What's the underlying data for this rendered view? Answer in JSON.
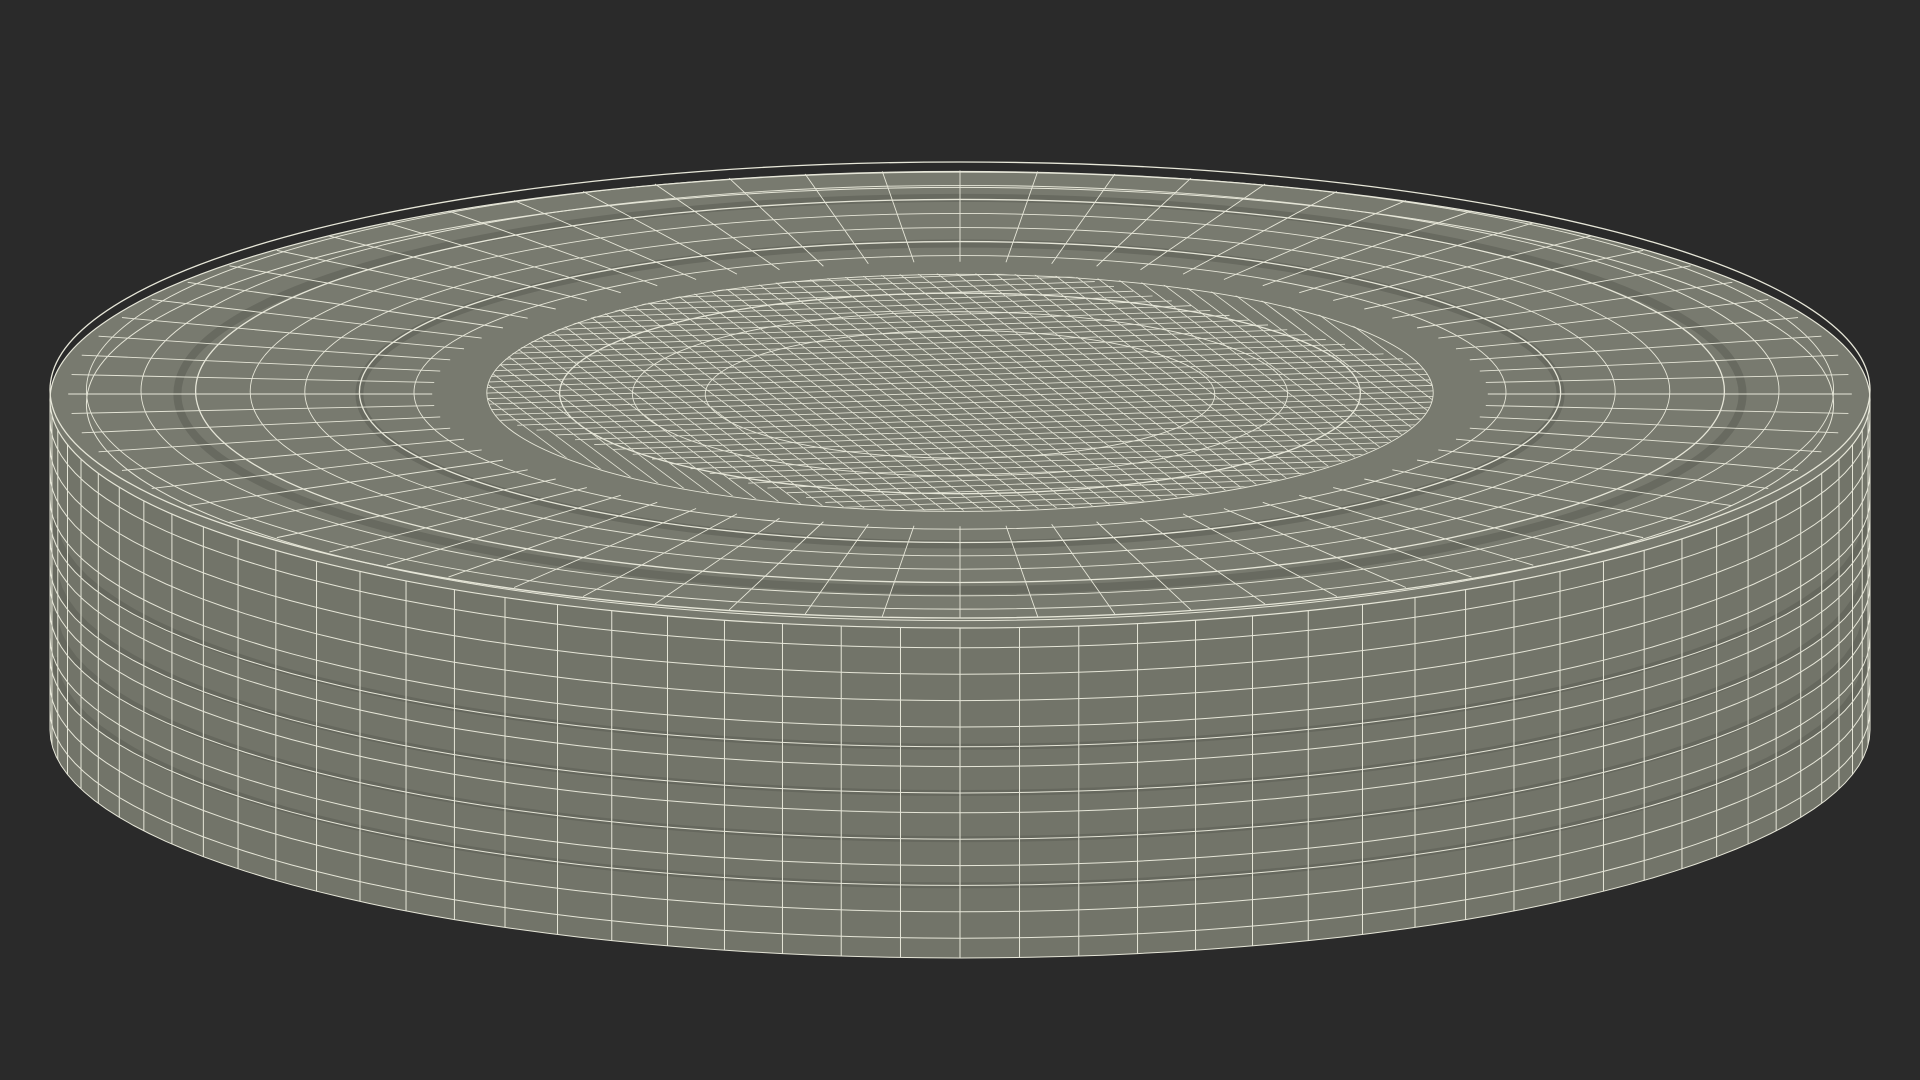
{
  "scene": {
    "subject": "wireframe-cylinder-lid",
    "colors": {
      "background": "#2a2a2a",
      "surface_top": "#787a6f",
      "surface_side": "#727469",
      "surface_dark": "#5d5f56",
      "wire": "#e6e6d8"
    }
  }
}
